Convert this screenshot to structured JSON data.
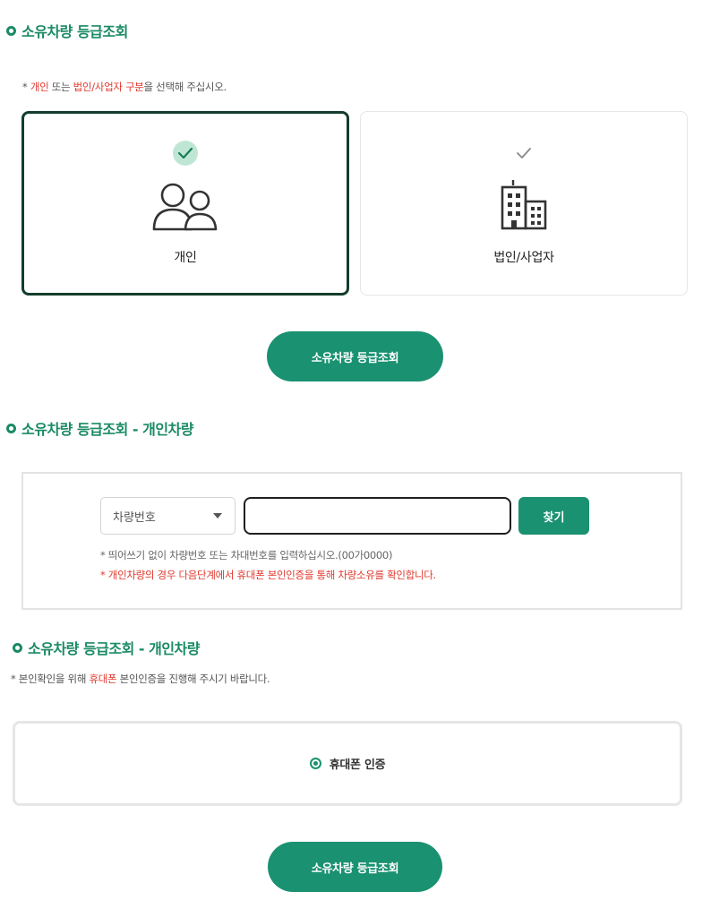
{
  "section1": {
    "title": "소유차량 등급조회",
    "note": {
      "prefix": "* ",
      "opt1": "개인",
      "mid1": " 또는 ",
      "opt2": "법인/사업자 구분",
      "suffix": "을 선택해 주십시오."
    },
    "cards": [
      {
        "label": "개인",
        "icon": "people-icon",
        "selected": true
      },
      {
        "label": "법인/사업자",
        "icon": "building-icon",
        "selected": false
      }
    ],
    "button_label": "소유차량 등급조회"
  },
  "section2": {
    "title": "소유차량 등급조회 - 개인차량",
    "select_value": "차량번호",
    "input_value": "",
    "find_label": "찾기",
    "note1": "* 띄어쓰기 없이 차량번호 또는 차대번호를 입력하십시오.(00가0000)",
    "note2": "* 개인차량의 경우 다음단계에서 휴대폰 본인인증을 통해 차량소유를 확인합니다."
  },
  "section3": {
    "title": "소유차량 등급조회 - 개인차량",
    "note": {
      "prefix": "* 본인확인을 위해 ",
      "highlight": "휴대폰",
      "suffix": " 본인인증을 진행해 주시기 바랍니다."
    },
    "radio_label": "휴대폰 인증",
    "radio_selected": true,
    "button_label": "소유차량 등급조회"
  },
  "colors": {
    "accent": "#1a9170",
    "title": "#1b8a66",
    "highlight": "#e03a2f",
    "selected_border": "#143d2c"
  }
}
